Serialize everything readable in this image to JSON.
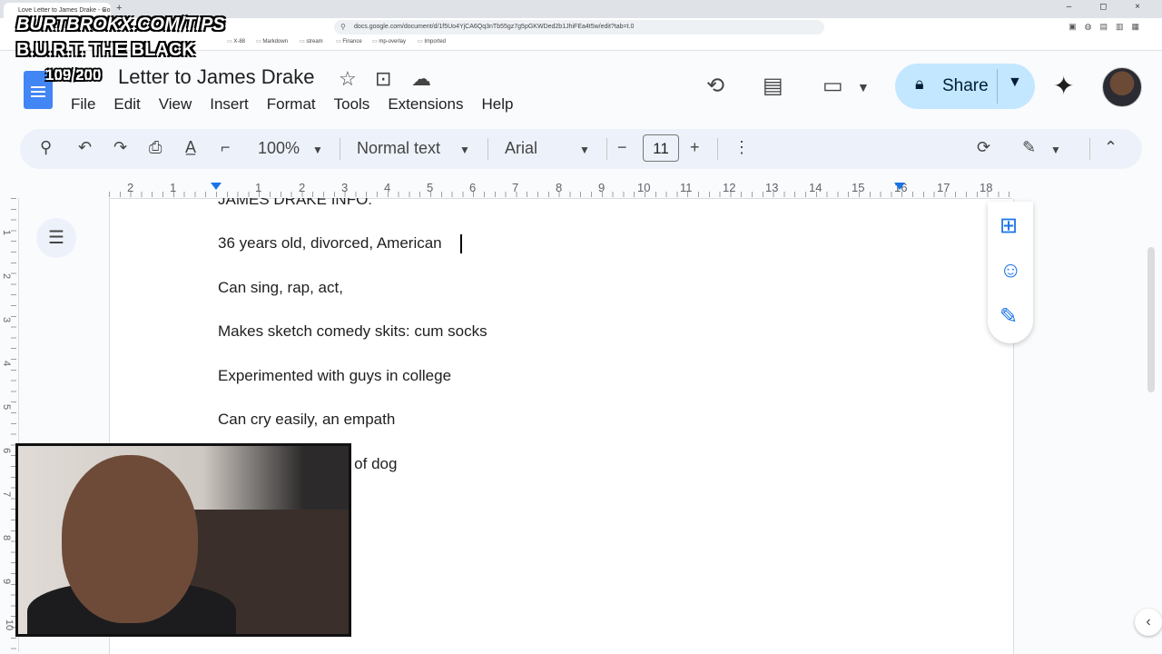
{
  "browser": {
    "tab_title": "Love Letter to James Drake - Go",
    "tab_close": "×",
    "new_tab": "+",
    "window_controls": "–  ◻  ×",
    "url": "docs.google.com/document/d/1f5Uo4YjCA6Qq3nTb55gz7g5pGKWDed2b1JhiFEa4t5w/edit?tab=t.0",
    "bookmarks": [
      "X-88",
      "Markdown",
      "stream",
      "Finance",
      "mp-overlay",
      "Imported"
    ]
  },
  "overlay": {
    "url_text": "BURTBROKX.COM/TIPS",
    "name_text": "B.U.R.T. THE BLACK",
    "count_text": "109/200"
  },
  "docs": {
    "title": "Letter to James Drake",
    "menus": [
      "File",
      "Edit",
      "View",
      "Insert",
      "Format",
      "Tools",
      "Extensions",
      "Help"
    ],
    "share_label": "Share"
  },
  "toolbar": {
    "zoom": "100%",
    "style": "Normal text",
    "font": "Arial",
    "font_size": "11"
  },
  "ruler": {
    "numbers": [
      "2",
      "1",
      "1",
      "2",
      "3",
      "4",
      "5",
      "6",
      "7",
      "8",
      "9",
      "10",
      "11",
      "12",
      "13",
      "14",
      "15",
      "16",
      "17",
      "18"
    ],
    "vertical_numbers": [
      "1",
      "2",
      "3",
      "4",
      "5",
      "6",
      "7",
      "8",
      "9",
      "10"
    ]
  },
  "document": {
    "lines": [
      "JAMES DRAKE INFO:",
      "36 years old, divorced, American",
      "Can sing, rap, act,",
      "Makes sketch comedy skits: cum socks",
      "Experimented with guys in college",
      "Can cry easily, an empath",
      "p of dog"
    ]
  },
  "colors": {
    "accent": "#1a73e8",
    "share_bg": "#c2e7ff",
    "toolbar_bg": "#edf2fa",
    "docs_blue": "#4285f4"
  }
}
